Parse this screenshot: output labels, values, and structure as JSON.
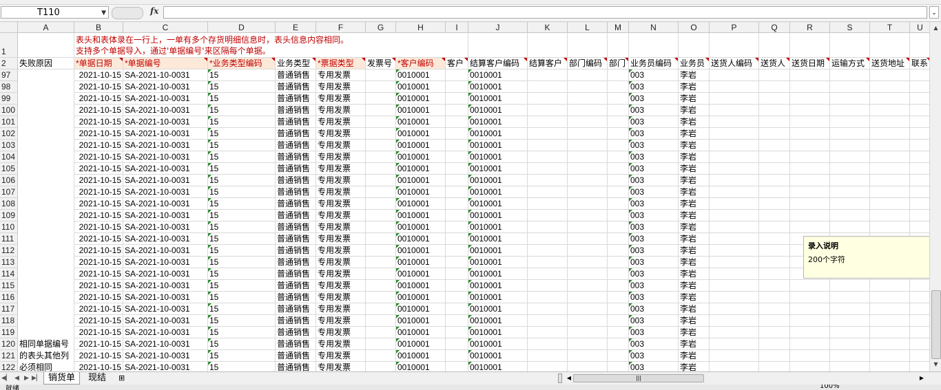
{
  "formula_bar": {
    "name_box": "T110",
    "fx": "fx",
    "formula": ""
  },
  "columns": [
    "A",
    "B",
    "C",
    "D",
    "E",
    "F",
    "G",
    "H",
    "I",
    "J",
    "K",
    "L",
    "M",
    "N",
    "O",
    "P",
    "Q",
    "R",
    "S",
    "T",
    "U"
  ],
  "row1": {
    "row_number": "1",
    "notes": [
      "表头和表体录在一行上，一单有多个存货明细信息时，表头信息内容相同。",
      "支持多个单据导入，通过'单据编号'来区隔每个单据。"
    ]
  },
  "header_row": {
    "row_number": "2",
    "cells": [
      "失败原因",
      "*单据日期",
      "*单据编号",
      "*业务类型编码",
      "业务类型",
      "*票据类型",
      "发票号",
      "*客户编码",
      "客户",
      "结算客户编码",
      "结算客户",
      "部门编码",
      "部门",
      "业务员编码",
      "业务员",
      "送货人编码",
      "送货人",
      "送货日期",
      "运输方式",
      "送货地址",
      "联系"
    ]
  },
  "data_rows": {
    "row_numbers": [
      "97",
      "98",
      "99",
      "100",
      "101",
      "102",
      "103",
      "104",
      "105",
      "106",
      "107",
      "108",
      "109",
      "110",
      "111",
      "112",
      "113",
      "114",
      "115",
      "116",
      "117",
      "118",
      "119",
      "120",
      "121",
      "122"
    ],
    "date": "2021-10-15",
    "doc_no": "SA-2021-10-0031",
    "biz_type_code": "15",
    "biz_type": "普通销售",
    "ticket_type": "专用发票",
    "customer_code": "0010001",
    "settle_customer_code": "0010001",
    "salesman_code": "003",
    "salesman": "李岩"
  },
  "fail_reason_text": [
    "相同单据编号",
    "的表头其他列",
    "必须相同"
  ],
  "tooltip": {
    "title": "录入说明",
    "body": "200个字符"
  },
  "sheet_tabs": [
    "销货单",
    "现结"
  ],
  "status": {
    "ready": "就绪",
    "zoom": "100%"
  }
}
